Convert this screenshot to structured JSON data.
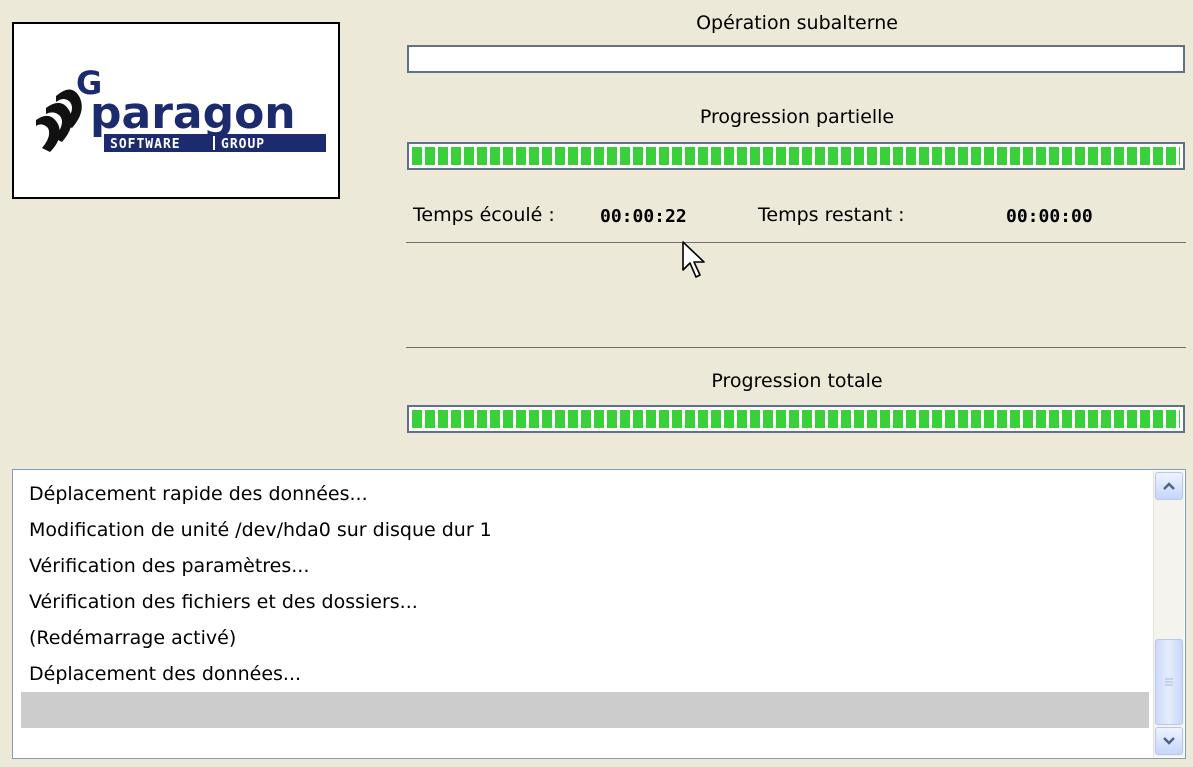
{
  "logo": {
    "brand": "paragon",
    "tagline_left": "SOFTWARE",
    "tagline_right": "GROUP"
  },
  "progress": {
    "sub_operation": {
      "label": "Opération subalterne",
      "value": 0.0
    },
    "partial": {
      "label": "Progression partielle",
      "value": 1.0
    },
    "total": {
      "label": "Progression totale",
      "value": 1.0
    }
  },
  "time": {
    "elapsed_label": "Temps écoulé :",
    "elapsed_value": "00:00:22",
    "remaining_label": "Temps restant :",
    "remaining_value": "00:00:00"
  },
  "log": {
    "items": [
      "Déplacement rapide des données...",
      "Modification de unité /dev/hda0 sur disque dur  1",
      "Vérification des paramètres...",
      "Vérification des fichiers et des dossiers...",
      "(Redémarrage activé)",
      "Déplacement des données...",
      ""
    ],
    "selected_index": 6
  },
  "icons": {
    "scroll_up": "chevron-up-icon",
    "scroll_down": "chevron-down-icon",
    "cursor": "mouse-pointer-icon"
  },
  "colors": {
    "background": "#ece9d8",
    "progress_fill": "#3ad03a",
    "logo_navy": "#1c2a6e",
    "selection": "#cccccc"
  }
}
